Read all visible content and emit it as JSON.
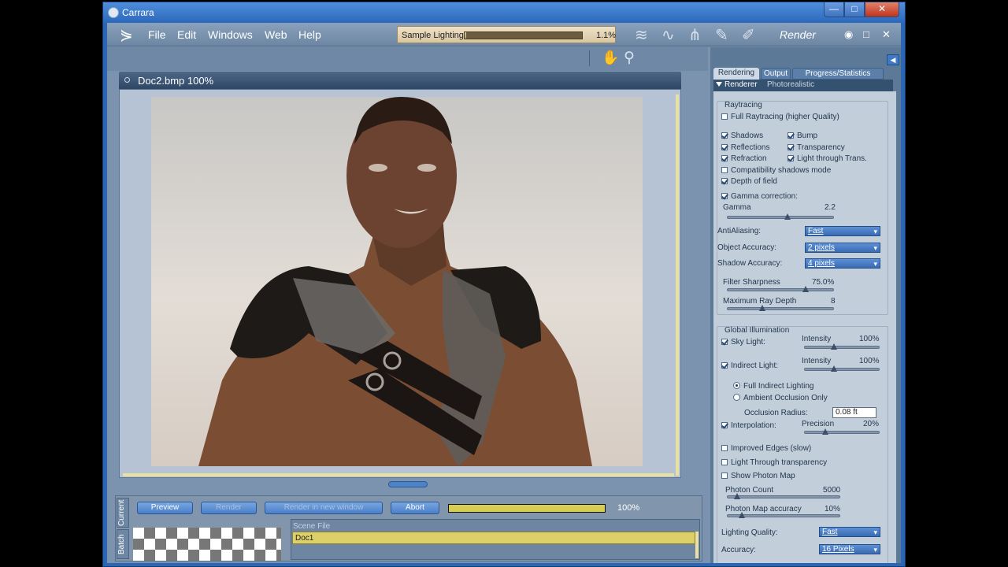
{
  "window": {
    "title": "Carrara",
    "min_glyph": "—",
    "max_glyph": "□",
    "close_glyph": "✕"
  },
  "menu": {
    "items": [
      "File",
      "Edit",
      "Windows",
      "Web",
      "Help"
    ]
  },
  "progress": {
    "label": "Sample Lighting",
    "value_text": "1.1%",
    "fraction": 0.011
  },
  "room": {
    "title": "Render",
    "eye_glyph": "◉",
    "max_glyph": "□",
    "close_glyph": "✕"
  },
  "document": {
    "title": "Doc2.bmp 100%"
  },
  "batch": {
    "tabs": {
      "current": "Current",
      "batch": "Batch"
    },
    "buttons": {
      "preview": "Preview",
      "render": "Render",
      "render_new": "Render in new window",
      "abort": "Abort"
    },
    "progress_text": "100%",
    "progress_fraction": 1.0,
    "scene_header": "Scene File",
    "scene_row": "Doc1"
  },
  "rpanel": {
    "tabs": {
      "rendering": "Rendering",
      "output": "Output",
      "progress": "Progress/Statistics"
    },
    "renderer_label": "Renderer",
    "renderer_value": "Photorealistic",
    "raytracing": {
      "title": "Raytracing",
      "full": "Full Raytracing (higher Quality)",
      "shadows": "Shadows",
      "bump": "Bump",
      "reflections": "Reflections",
      "transparency": "Transparency",
      "refraction": "Refraction",
      "light_through": "Light through Trans.",
      "compat": "Compatibility shadows mode",
      "dof": "Depth of field",
      "gamma_corr": "Gamma correction:",
      "gamma_label": "Gamma",
      "gamma_value": "2.2",
      "aa_label": "AntiAliasing:",
      "aa_value": "Fast",
      "obj_label": "Object Accuracy:",
      "obj_value": "2 pixels",
      "shadow_label": "Shadow Accuracy:",
      "shadow_value": "4 pixels",
      "filter_label": "Filter Sharpness",
      "filter_value": "75.0%",
      "raydepth_label": "Maximum Ray Depth",
      "raydepth_value": "8"
    },
    "gi": {
      "title": "Global Illumination",
      "sky": "Sky Light:",
      "intensity": "Intensity",
      "sky_value": "100%",
      "indirect": "Indirect Light:",
      "indirect_value": "100%",
      "full_indirect": "Full Indirect Lighting",
      "ambient": "Ambient Occlusion Only",
      "occl_label": "Occlusion Radius:",
      "occl_value": "0.08 ft",
      "interp": "Interpolation:",
      "precision": "Precision",
      "precision_value": "20%",
      "improved": "Improved Edges (slow)",
      "light_through": "Light Through transparency",
      "photon_map": "Show Photon Map",
      "photon_count_label": "Photon Count",
      "photon_count_value": "5000",
      "photon_acc_label": "Photon Map accuracy",
      "photon_acc_value": "10%",
      "lq_label": "Lighting Quality:",
      "lq_value": "Fast",
      "acc_label": "Accuracy:",
      "acc_value": "16 Pixels"
    }
  },
  "colors": {
    "title_bar": "#2c68bb",
    "panel": "#c3cedb",
    "accent": "#ddd069"
  }
}
